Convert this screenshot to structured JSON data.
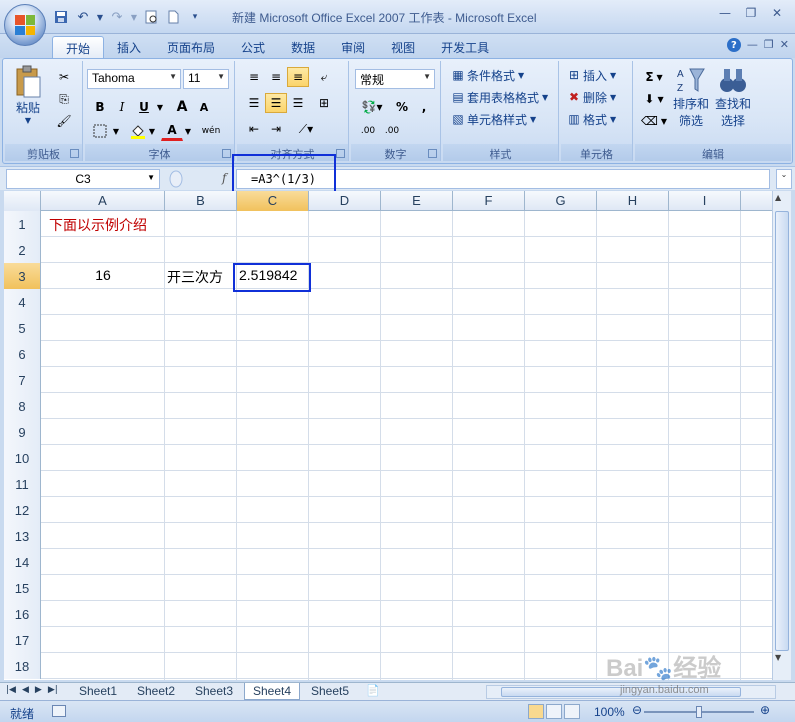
{
  "window": {
    "title": "新建 Microsoft Office Excel 2007 工作表 - Microsoft Excel"
  },
  "quick_access": [
    "save-icon",
    "undo-icon",
    "redo-icon",
    "print-preview-icon",
    "new-document-icon",
    "customize-icon"
  ],
  "tabs": [
    {
      "label": "开始",
      "active": true
    },
    {
      "label": "插入"
    },
    {
      "label": "页面布局"
    },
    {
      "label": "公式"
    },
    {
      "label": "数据"
    },
    {
      "label": "审阅"
    },
    {
      "label": "视图"
    },
    {
      "label": "开发工具"
    }
  ],
  "ribbon": {
    "clipboard": {
      "label": "剪贴板",
      "paste": "粘贴"
    },
    "font": {
      "label": "字体",
      "font_name": "Tahoma",
      "font_size": "11",
      "bold": "B",
      "italic": "I",
      "underline": "U",
      "grow": "A",
      "shrink": "A",
      "font_color_letter": "A",
      "phonetic": "wén"
    },
    "alignment": {
      "label": "对齐方式"
    },
    "number": {
      "label": "数字",
      "format": "常规",
      "percent": "%",
      "comma": ",",
      "inc_decimal": ".00",
      "dec_decimal": ".00"
    },
    "styles": {
      "label": "样式",
      "conditional": "条件格式",
      "table": "套用表格格式",
      "cell_styles": "单元格样式"
    },
    "cells": {
      "label": "单元格",
      "insert": "插入",
      "delete": "删除",
      "format": "格式"
    },
    "editing": {
      "label": "编辑",
      "sort_filter_1": "排序和",
      "sort_filter_2": "筛选",
      "find_select_1": "查找和",
      "find_select_2": "选择",
      "sigma": "Σ"
    }
  },
  "formula_bar": {
    "name_box": "C3",
    "fx": "f",
    "formula": "=A3^(1/3)"
  },
  "columns": [
    "A",
    "B",
    "C",
    "D",
    "E",
    "F",
    "G",
    "H",
    "I"
  ],
  "active_column": "C",
  "rows": [
    "1",
    "2",
    "3",
    "4",
    "5",
    "6",
    "7",
    "8",
    "9",
    "10",
    "11",
    "12",
    "13",
    "14",
    "15",
    "16",
    "17",
    "18"
  ],
  "active_row": "3",
  "cells": {
    "A1": "下面以示例介绍",
    "A3": "16",
    "B3": "开三次方",
    "C3": "2.519842"
  },
  "colors": {
    "A1_text": "#c00000",
    "highlight_box": "#1030d8"
  },
  "sheets": [
    "Sheet1",
    "Sheet2",
    "Sheet3",
    "Sheet4",
    "Sheet5"
  ],
  "active_sheet": "Sheet4",
  "status": {
    "ready": "就绪",
    "zoom": "100%"
  },
  "watermark": {
    "logo": "Baidu 经验",
    "url": "jingyan.baidu.com"
  }
}
